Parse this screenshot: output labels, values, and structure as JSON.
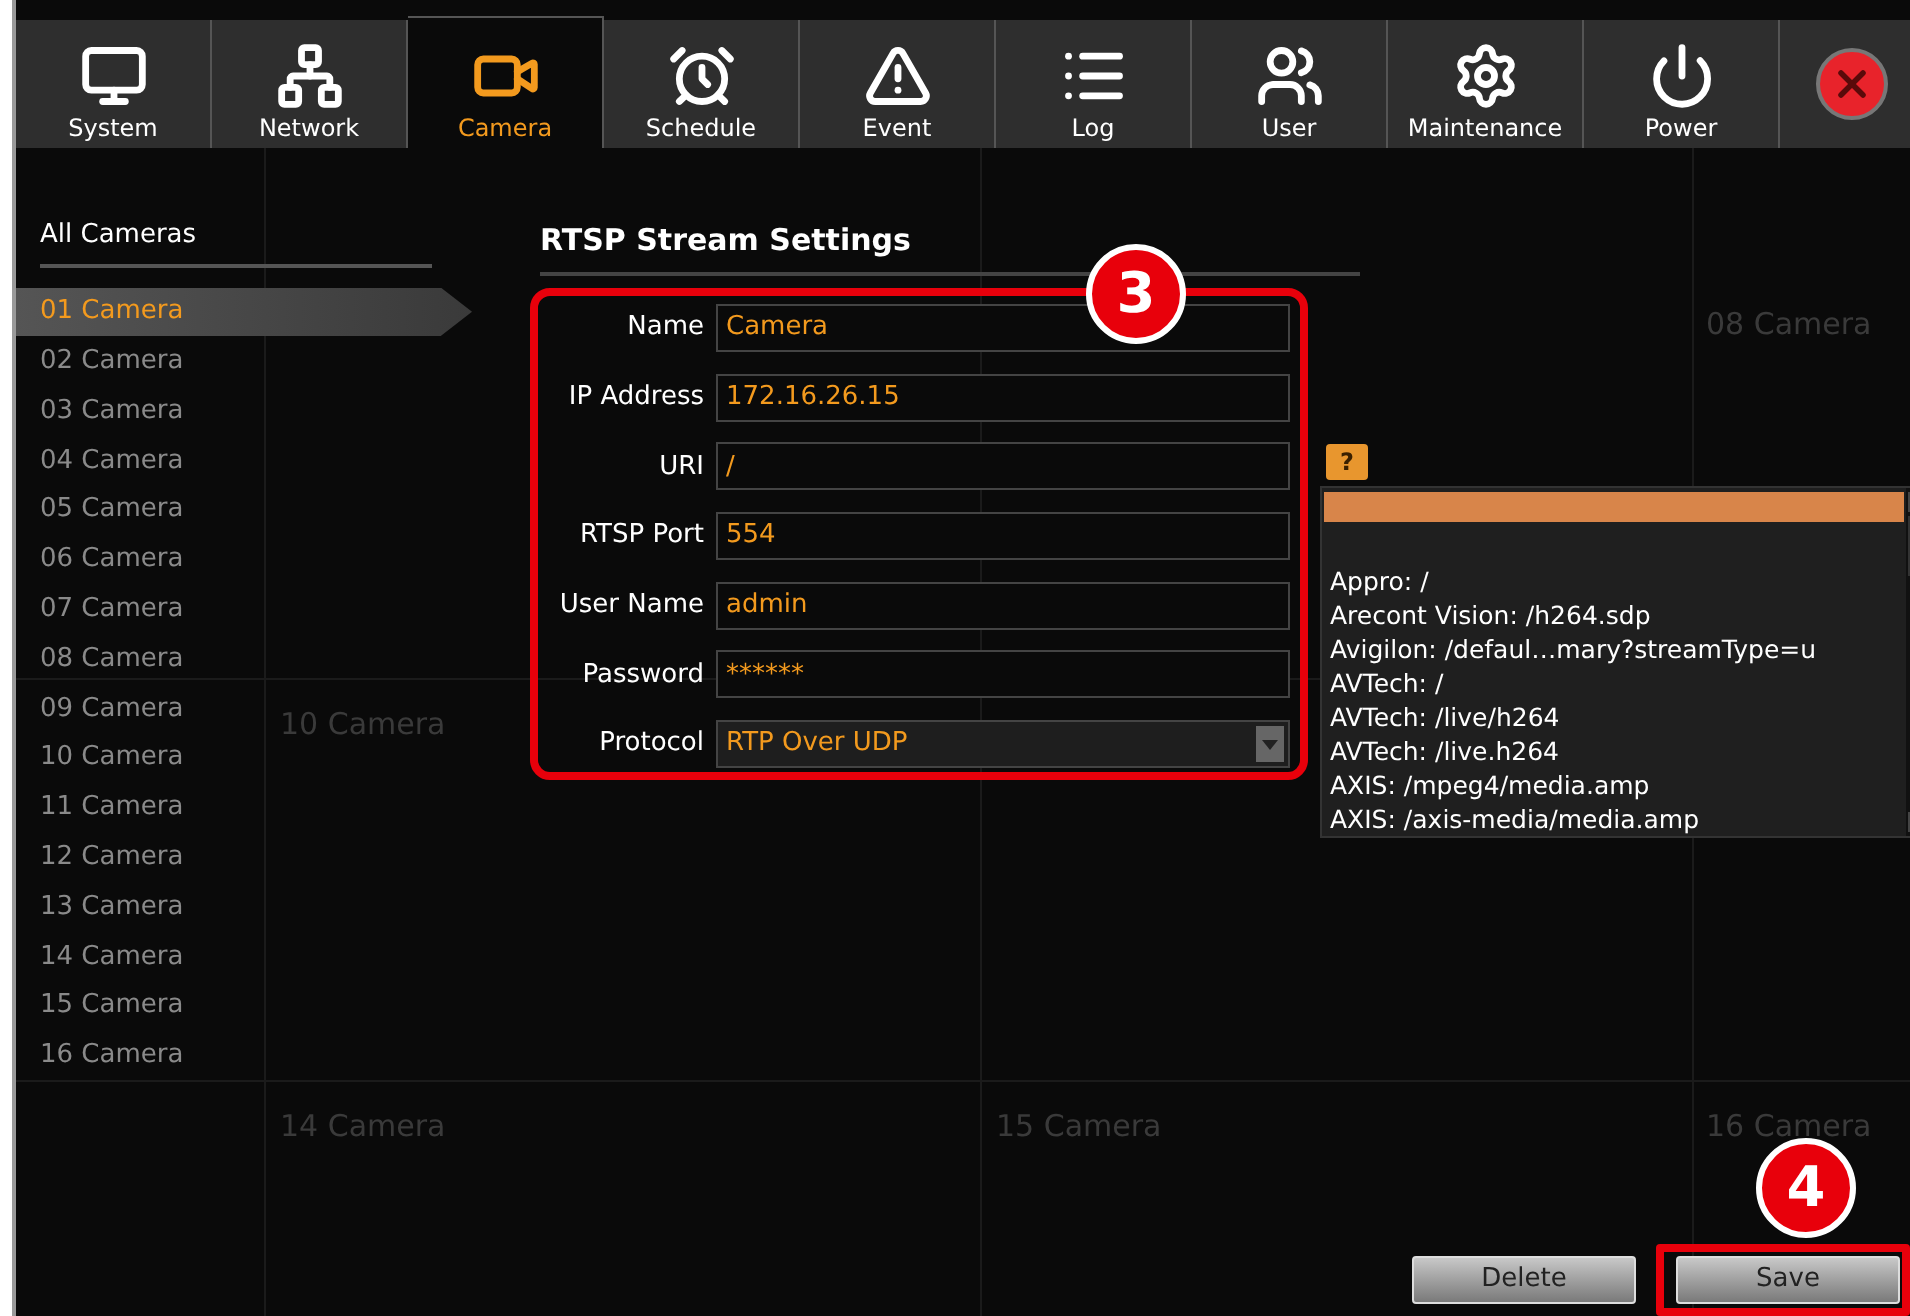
{
  "tabs": [
    {
      "label": "System",
      "kind": "monitor",
      "selected": false
    },
    {
      "label": "Network",
      "kind": "network",
      "selected": false
    },
    {
      "label": "Camera",
      "kind": "camera",
      "selected": true
    },
    {
      "label": "Schedule",
      "kind": "clock",
      "selected": false
    },
    {
      "label": "Event",
      "kind": "warning",
      "selected": false
    },
    {
      "label": "Log",
      "kind": "list",
      "selected": false
    },
    {
      "label": "User",
      "kind": "users",
      "selected": false
    },
    {
      "label": "Maintenance",
      "kind": "gear",
      "selected": false
    },
    {
      "label": "Power",
      "kind": "power",
      "selected": false
    }
  ],
  "background_labels": [
    {
      "label": "08 Camera",
      "kind": "top-right"
    },
    {
      "label": "10 Camera",
      "kind": "middle-left"
    },
    {
      "label": "14 Camera",
      "kind": "bottom-left"
    },
    {
      "label": "15 Camera",
      "kind": "bottom-middle"
    },
    {
      "label": "16 Camera",
      "kind": "bottom-right"
    }
  ],
  "sidebar": {
    "title": "All Cameras",
    "items": [
      {
        "label": "01 Camera",
        "selected": true
      },
      {
        "label": "02 Camera",
        "selected": false
      },
      {
        "label": "03 Camera",
        "selected": false
      },
      {
        "label": "04 Camera",
        "selected": false
      },
      {
        "label": "05 Camera",
        "selected": false
      },
      {
        "label": "06 Camera",
        "selected": false
      },
      {
        "label": "07 Camera",
        "selected": false
      },
      {
        "label": "08 Camera",
        "selected": false
      },
      {
        "label": "09 Camera",
        "selected": false
      },
      {
        "label": "10 Camera",
        "selected": false
      },
      {
        "label": "11 Camera",
        "selected": false
      },
      {
        "label": "12 Camera",
        "selected": false
      },
      {
        "label": "13 Camera",
        "selected": false
      },
      {
        "label": "14 Camera",
        "selected": false
      },
      {
        "label": "15 Camera",
        "selected": false
      },
      {
        "label": "16 Camera",
        "selected": false
      }
    ]
  },
  "form": {
    "title": "RTSP Stream Settings",
    "fields": [
      {
        "label": "Name",
        "value": "Camera",
        "kind": "text"
      },
      {
        "label": "IP Address",
        "value": "172.16.26.15",
        "kind": "text"
      },
      {
        "label": "URI",
        "value": "/",
        "kind": "text"
      },
      {
        "label": "RTSP Port",
        "value": "554",
        "kind": "text"
      },
      {
        "label": "User Name",
        "value": "admin",
        "kind": "text"
      },
      {
        "label": "Password",
        "value": "******",
        "kind": "text"
      },
      {
        "label": "Protocol",
        "value": "RTP Over UDP",
        "kind": "select"
      }
    ],
    "help_button": "?",
    "uri_suggestions": {
      "first_row_selected": true,
      "items": [
        "Appro: /",
        "Arecont Vision: /h264.sdp",
        "Avigilon: /defaul…mary?streamType=u",
        "AVTech: /",
        "AVTech: /live/h264",
        "AVTech: /live.h264",
        "AXIS: /mpeg4/media.amp",
        "AXIS: /axis-media/media.amp"
      ]
    }
  },
  "delete_button": "Delete",
  "save_button": "Save",
  "callouts": [
    {
      "number": "3",
      "kind": "form"
    },
    {
      "number": "4",
      "kind": "save"
    }
  ]
}
